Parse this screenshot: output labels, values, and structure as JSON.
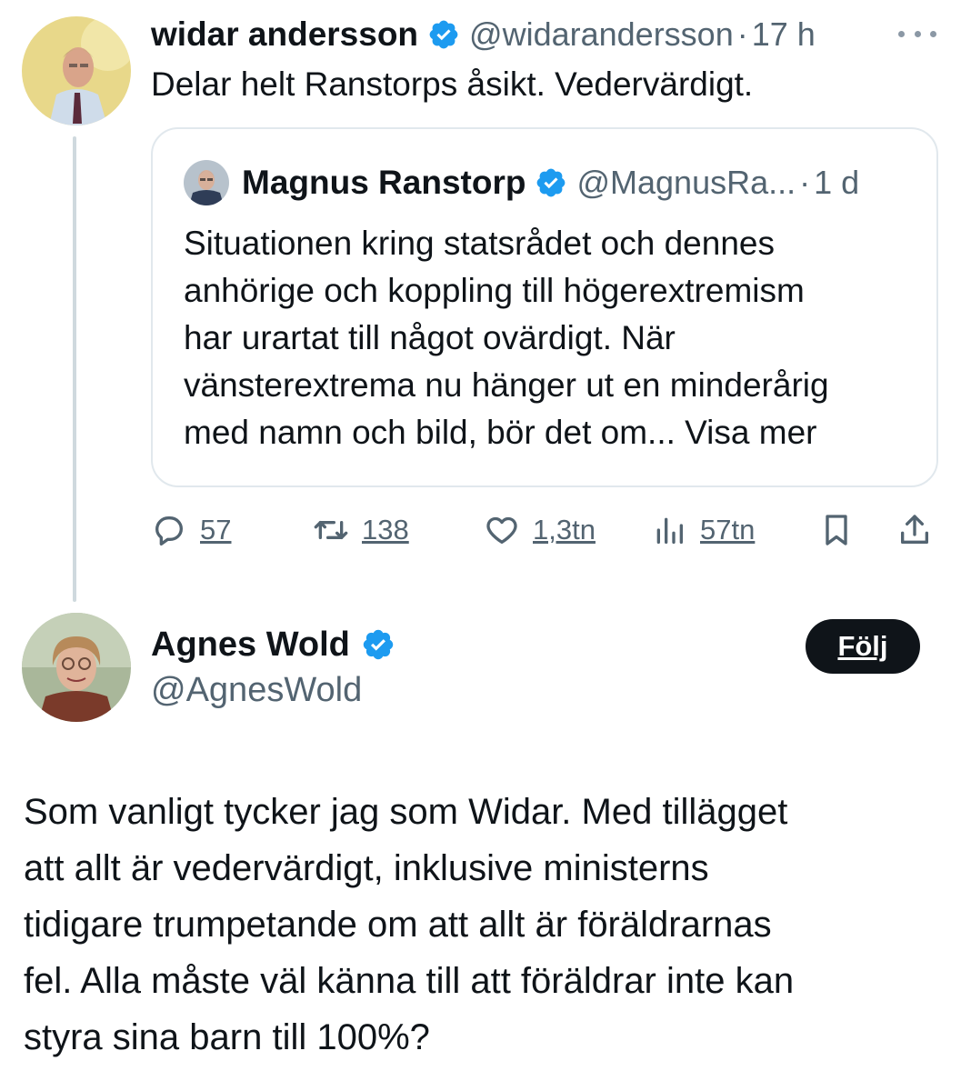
{
  "tweet1": {
    "display_name": "widar andersson",
    "handle": "@widarandersson",
    "time": "17 h",
    "separator": "·",
    "text": "Delar helt Ranstorps åsikt. Vedervärdigt.",
    "more_icon": "more-horizontal-icon",
    "verified_icon": "verified-badge-icon",
    "quote": {
      "display_name": "Magnus Ranstorp",
      "handle": "@MagnusRa...",
      "time": "1 d",
      "separator": "·",
      "text_lines": [
        "Situationen kring statsrådet och dennes",
        "anhörige och koppling till högerextremism",
        "har urartat till något ovärdigt. När",
        "vänsterextrema nu hänger ut en minderårig",
        "med namn och bild, bör det om... Visa mer"
      ]
    },
    "actions": {
      "reply": {
        "icon": "reply-icon",
        "count": "57"
      },
      "retweet": {
        "icon": "retweet-icon",
        "count": "138"
      },
      "like": {
        "icon": "heart-icon",
        "count": "1,3tn"
      },
      "views": {
        "icon": "views-chart-icon",
        "count": "57tn"
      },
      "bookmark": {
        "icon": "bookmark-icon"
      },
      "share": {
        "icon": "share-icon"
      }
    }
  },
  "tweet2": {
    "display_name": "Agnes Wold",
    "handle": "@AgnesWold",
    "follow_label": "Följ",
    "text_lines": [
      "Som vanligt tycker jag som Widar. Med tillägget",
      "att allt är vedervärdigt, inklusive ministerns",
      "tidigare trumpetande om att allt är föräldrarnas",
      "fel. Alla måste väl känna till att föräldrar inte kan",
      "styra sina barn till 100%?"
    ]
  },
  "colors": {
    "text": "#0f1419",
    "secondary": "#536471",
    "verified_blue": "#1d9bf0",
    "border": "#e1e8ed",
    "thread_line": "#cfd9de",
    "button_bg": "#0f1419"
  }
}
